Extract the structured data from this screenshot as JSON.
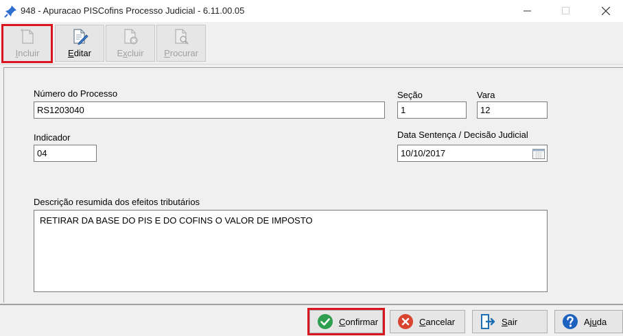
{
  "window": {
    "title": "948 - Apuracao PISCofins Processo Judicial - 6.11.00.05",
    "title_icon": "pin-icon",
    "controls": [
      "minimize-icon",
      "maximize-icon",
      "close-icon"
    ]
  },
  "toolbar": {
    "buttons": [
      {
        "label_pre": "",
        "label_acc": "I",
        "label_post": "ncluir",
        "icon": "new-document-icon",
        "enabled": false,
        "highlighted": true
      },
      {
        "label_pre": "",
        "label_acc": "E",
        "label_post": "ditar",
        "icon": "edit-document-icon",
        "enabled": true
      },
      {
        "label_pre": "E",
        "label_acc": "x",
        "label_post": "cluir",
        "icon": "delete-document-icon",
        "enabled": false
      },
      {
        "label_pre": "",
        "label_acc": "P",
        "label_post": "rocurar",
        "icon": "search-document-icon",
        "enabled": false
      }
    ]
  },
  "form": {
    "numero_processo": {
      "label": "Número do Processo",
      "value": "RS1203040"
    },
    "secao": {
      "label": "Seção",
      "value": "1"
    },
    "vara": {
      "label": "Vara",
      "value": "12"
    },
    "indicador": {
      "label": "Indicador",
      "value": "04"
    },
    "data_sentenca": {
      "label": "Data Sentença / Decisão Judicial",
      "value": "10/10/2017",
      "icon": "calendar-icon"
    },
    "descricao": {
      "label": "Descrição resumida dos efeitos tributários",
      "value": "RETIRAR DA BASE DO PIS E DO COFINS O VALOR DE IMPOSTO"
    }
  },
  "footer": {
    "confirmar": {
      "label_pre": "",
      "label_acc": "C",
      "label_post": "onfirmar",
      "icon": "check-circle-icon",
      "highlighted": true
    },
    "cancelar": {
      "label_pre": "",
      "label_acc": "C",
      "label_post": "ancelar",
      "icon": "cancel-circle-icon"
    },
    "sair": {
      "label_pre": "",
      "label_acc": "S",
      "label_post": "air",
      "icon": "exit-door-icon"
    },
    "ajuda": {
      "label_pre": "Aj",
      "label_acc": "u",
      "label_post": "da",
      "icon": "help-circle-icon"
    }
  },
  "colors": {
    "highlight": "#d9141e",
    "confirm_green": "#2e9e4f",
    "cancel_red": "#d9452e",
    "exit_blue": "#1c6fb5",
    "help_blue": "#1e62c0"
  }
}
